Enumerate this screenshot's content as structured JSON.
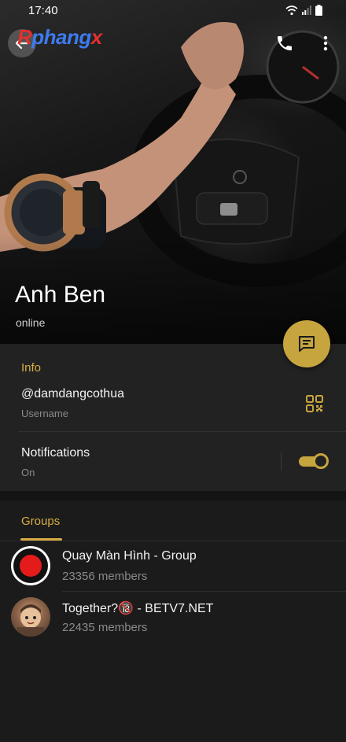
{
  "status_bar": {
    "time": "17:40"
  },
  "header": {
    "brand": {
      "part1": "R",
      "part2": "phang",
      "part3": "x"
    },
    "profile_name": "Anh Ben",
    "profile_status": "online"
  },
  "info": {
    "section_title": "Info",
    "username": {
      "value": "@damdangcothua",
      "label": "Username"
    },
    "notifications": {
      "label": "Notifications",
      "state": "On",
      "enabled": true
    }
  },
  "groups": {
    "tab_label": "Groups",
    "items": [
      {
        "name": "Quay Màn Hình - Group",
        "members": "23356 members"
      },
      {
        "name": "Together?🔞 - BETV7.NET",
        "members": "22435 members"
      }
    ]
  },
  "colors": {
    "accent": "#c7a53e",
    "accent_text": "#d8ad44",
    "record_red": "#e31b1b"
  },
  "icons": [
    "back-arrow-icon",
    "phone-icon",
    "more-vertical-icon",
    "message-icon",
    "qr-code-icon",
    "wifi-icon",
    "signal-icon",
    "battery-icon"
  ]
}
